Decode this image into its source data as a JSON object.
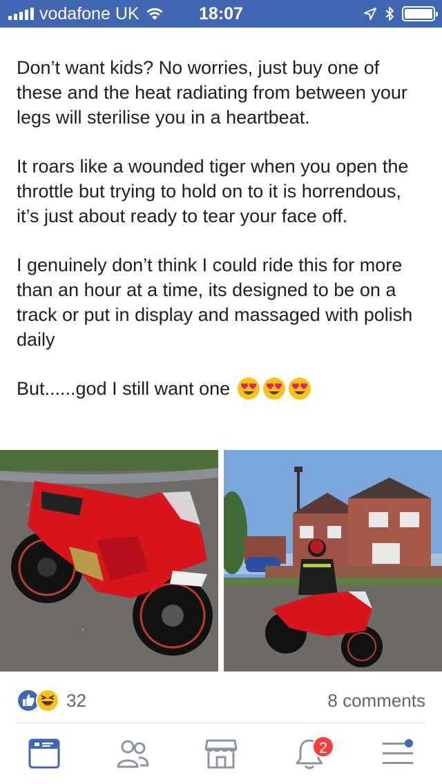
{
  "status_bar": {
    "carrier": "vodafone UK",
    "time": "18:07"
  },
  "post": {
    "paragraphs": [
      "Don’t want kids? No worries, just buy one of these and the heat radiating from between your legs will sterilise you in a heartbeat.",
      "It roars like a wounded tiger when you open the throttle but trying to hold on to it is horrendous, it’s just about ready to tear your face off.",
      "I genuinely don’t think I could ride this for more than an hour at a time, its designed to be on a track or put in display and massaged with polish daily",
      "But......god I still want one"
    ],
    "emojis": [
      "heart-eyes-emoji",
      "heart-eyes-emoji",
      "heart-eyes-emoji"
    ],
    "photos": [
      {
        "subject": "red-sport-motorcycle-photo"
      },
      {
        "subject": "rider-on-red-motorcycle-photo"
      }
    ]
  },
  "reactions": {
    "icons": [
      "like-reaction-icon",
      "haha-reaction-icon"
    ],
    "count": "32",
    "comments": "8 comments"
  },
  "tab_bar": {
    "tabs": [
      {
        "icon": "news-feed-icon",
        "active": true
      },
      {
        "icon": "friends-icon",
        "active": false
      },
      {
        "icon": "marketplace-icon",
        "active": false
      },
      {
        "icon": "notifications-icon",
        "active": false,
        "badge": "2"
      },
      {
        "icon": "menu-icon",
        "active": false
      }
    ]
  },
  "colors": {
    "brand_blue": "#4267b2",
    "active_tab": "#4267b2",
    "inactive_tab": "#8d949e",
    "badge_red": "#fa3e3e"
  }
}
